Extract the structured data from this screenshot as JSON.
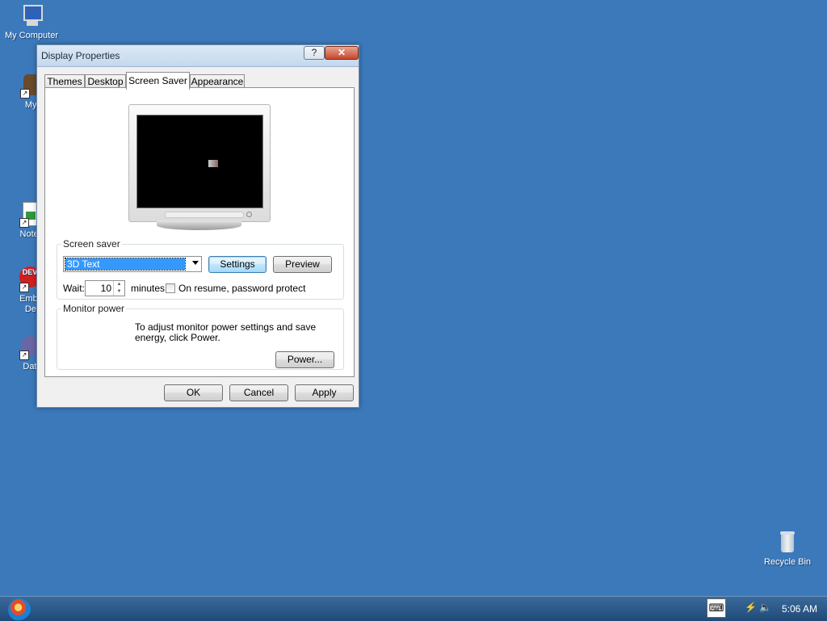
{
  "desktop": {
    "icons": [
      {
        "label": "My Computer"
      },
      {
        "label": "MyPa"
      },
      {
        "label": "Notepa"
      },
      {
        "label": "Embarc\nDev-C"
      },
      {
        "label": "DataW"
      },
      {
        "label": "Recycle Bin"
      }
    ]
  },
  "window": {
    "title": "Display Properties",
    "help_glyph": "?",
    "close_glyph": "✕",
    "tabs": [
      {
        "label": "Themes"
      },
      {
        "label": "Desktop"
      },
      {
        "label": "Screen Saver",
        "active": true
      },
      {
        "label": "Appearance"
      }
    ],
    "screen_saver": {
      "group_label": "Screen saver",
      "selected": "3D Text",
      "settings_label": "Settings",
      "preview_label": "Preview",
      "wait_label": "Wait:",
      "wait_value": "10",
      "minutes_label": "minutes",
      "password_label": "On resume, password protect",
      "password_checked": false
    },
    "monitor_power": {
      "group_label": "Monitor power",
      "text": "To adjust monitor power settings and save energy, click Power.",
      "power_label": "Power..."
    },
    "buttons": {
      "ok": "OK",
      "cancel": "Cancel",
      "apply": "Apply"
    }
  },
  "taskbar": {
    "clock": "5:06 AM",
    "keyboard_icon": "keyboard-icon"
  },
  "colors": {
    "desktop": "#3b79bb",
    "selection": "#3399ff"
  }
}
